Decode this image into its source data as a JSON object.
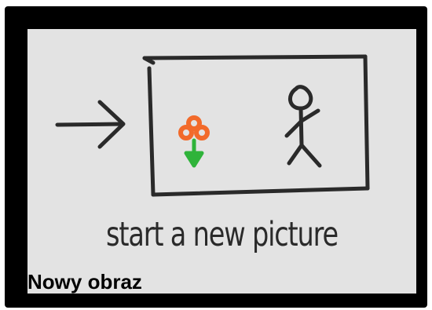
{
  "tile": {
    "caption": "start a new picture",
    "label": "Nowy obraz",
    "icons": [
      "arrow-right-icon",
      "picture-frame-icon",
      "flower-icon",
      "stick-figure-icon"
    ]
  },
  "colors": {
    "frame": "#000000",
    "tile_background": "#e3e3e3",
    "ink": "#2a2a2a",
    "flower_petals": "#f26a2a",
    "flower_leaves": "#2fb33a"
  }
}
